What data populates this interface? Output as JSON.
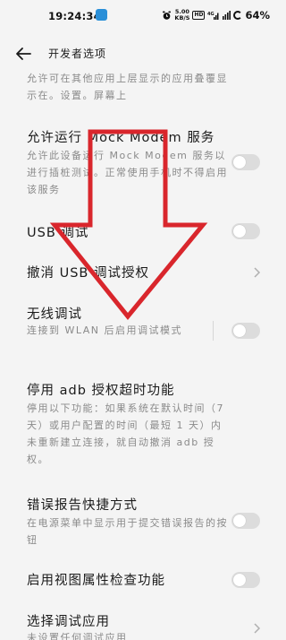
{
  "status_bar": {
    "time": "19:24:34",
    "network_speed": "5.00",
    "network_speed_unit": "KB/S",
    "hd_badge": "HD",
    "battery": "64%"
  },
  "header": {
    "title": "开发者选项"
  },
  "settings": {
    "overlay_desc": "允许可在其他应用上层显示的应用叠覆显示在。设置。屏幕上",
    "mock_modem": {
      "title": "允许运行 Mock Modem 服务",
      "desc": "允许此设备运行 Mock Modem 服务以进行插桩测试。正常使用手机时不得启用该服务"
    },
    "usb_debug": {
      "title": "USB 调试"
    },
    "revoke_usb": {
      "title": "撤消 USB 调试授权"
    },
    "wireless_debug": {
      "title": "无线调试",
      "desc": "连接到 WLAN 后启用调试模式"
    },
    "adb_timeout": {
      "title": "停用 adb 授权超时功能",
      "desc": "停用以下功能：如果系统在默认时间（7 天）或用户配置的时间（最短 1 天）内未重新建立连接，就自动撤消 adb 授权。"
    },
    "bug_report": {
      "title": "错误报告快捷方式",
      "desc": "在电源菜单中显示用于提交错误报告的按钮"
    },
    "view_attr": {
      "title": "启用视图属性检查功能"
    },
    "select_debug_app": {
      "title": "选择调试应用",
      "desc": "未设置任何调试应用"
    }
  },
  "colors": {
    "overlay_arrow": "#d9262c",
    "toggle_off": "#dcdcdc"
  }
}
